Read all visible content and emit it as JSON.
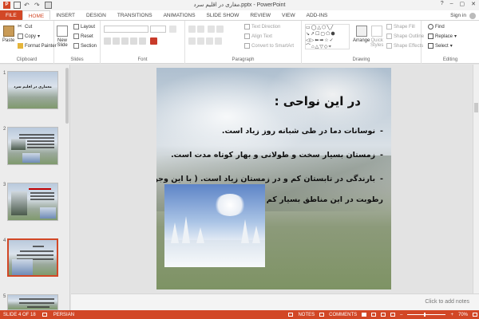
{
  "window": {
    "title": "مغاری در اقلیم سرد.pptx - PowerPoint",
    "controls": [
      "?",
      "–",
      "▢",
      "✕"
    ],
    "sign_in": "Sign in"
  },
  "tabs": [
    "FILE",
    "HOME",
    "INSERT",
    "DESIGN",
    "TRANSITIONS",
    "ANIMATIONS",
    "SLIDE SHOW",
    "REVIEW",
    "VIEW",
    "ADD-INS"
  ],
  "active_tab": "HOME",
  "ribbon": {
    "clipboard": {
      "paste": "Paste",
      "cut": "Cut",
      "copy": "Copy",
      "format_painter": "Format Painter",
      "label": "Clipboard"
    },
    "slides": {
      "new_slide_line1": "New",
      "new_slide_line2": "Slide",
      "layout": "Layout",
      "reset": "Reset",
      "section": "Section",
      "label": "Slides"
    },
    "font": {
      "label": "Font"
    },
    "paragraph": {
      "text_direction": "Text Direction",
      "align_text": "Align Text",
      "convert_smartart": "Convert to SmartArt",
      "label": "Paragraph"
    },
    "drawing": {
      "arrange": "Arrange",
      "quick_styles_line1": "Quick",
      "quick_styles_line2": "Styles",
      "shape_fill": "Shape Fill",
      "shape_outline": "Shape Outline",
      "shape_effects": "Shape Effects",
      "label": "Drawing"
    },
    "editing": {
      "find": "Find",
      "replace": "Replace",
      "select": "Select",
      "label": "Editing"
    }
  },
  "thumbnails": [
    {
      "number": "1",
      "title": "معماری در اقلیم سرد"
    },
    {
      "number": "2"
    },
    {
      "number": "3"
    },
    {
      "number": "4",
      "selected": true
    },
    {
      "number": "5"
    }
  ],
  "slide": {
    "title": "در این نواحی :",
    "bullets": [
      "نوسانات دما در طی شبانه روز زیاد است.",
      "زمستان بسیار سخت و طولانی و بهار کوتاه مدت است.",
      "بارندگی در تابستان کم و در زمستان زیاد است. ( با این وجود",
      "رطوبت در این مناطق بسیار کم است)"
    ]
  },
  "notes_placeholder": "Click to add notes",
  "status": {
    "slide_indicator": "SLIDE 4 OF 18",
    "language": "PERSIAN",
    "notes": "NOTES",
    "comments": "COMMENTS",
    "zoom": "70%",
    "zoom_level": 0.7
  },
  "colors": {
    "accent": "#d24726"
  }
}
